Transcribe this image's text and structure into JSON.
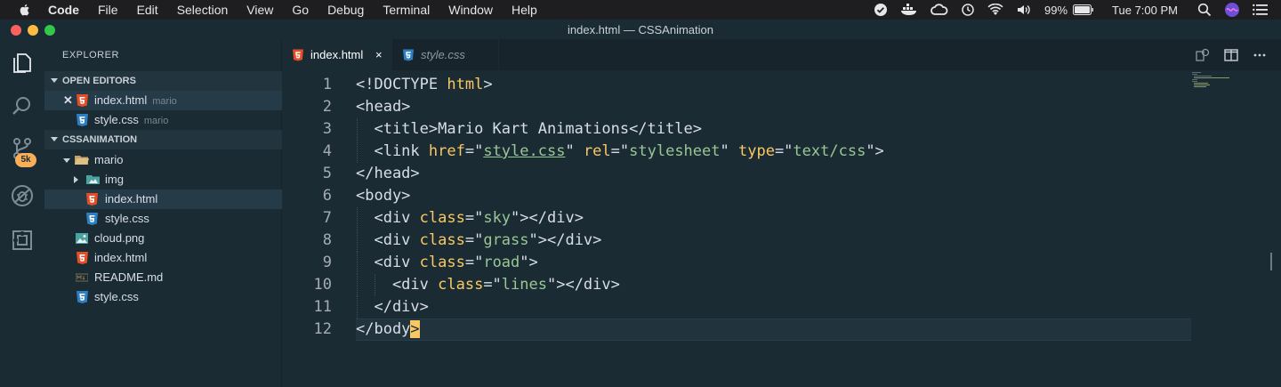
{
  "menubar": {
    "app": "Code",
    "items": [
      "File",
      "Edit",
      "Selection",
      "View",
      "Go",
      "Debug",
      "Terminal",
      "Window",
      "Help"
    ],
    "battery": "99%",
    "clock": "Tue 7:00 PM"
  },
  "window": {
    "title": "index.html — CSSAnimation"
  },
  "activity": {
    "badge": "5k"
  },
  "sidebar": {
    "title": "EXPLORER",
    "open_editors_header": "OPEN EDITORS",
    "open_editors": [
      {
        "name": "index.html",
        "folder": "mario",
        "icon": "html5-icon"
      },
      {
        "name": "style.css",
        "folder": "mario",
        "icon": "css3-icon"
      }
    ],
    "project_header": "CSSANIMATION",
    "tree": [
      {
        "name": "mario",
        "icon": "folder-open-icon"
      },
      {
        "name": "img",
        "icon": "image-folder-icon"
      },
      {
        "name": "index.html",
        "icon": "html5-icon"
      },
      {
        "name": "style.css",
        "icon": "css3-icon"
      },
      {
        "name": "cloud.png",
        "icon": "image-icon"
      },
      {
        "name": "index.html",
        "icon": "html5-icon"
      },
      {
        "name": "README.md",
        "icon": "markdown-icon"
      },
      {
        "name": "style.css",
        "icon": "css3-icon"
      }
    ]
  },
  "editor": {
    "tabs": [
      {
        "label": "index.html",
        "close": "×"
      },
      {
        "label": "style.css"
      }
    ],
    "lines": [
      {
        "n": "1",
        "tokens": [
          [
            "t",
            "<!DOCTYPE "
          ],
          [
            "a",
            "html"
          ],
          [
            "t",
            ">"
          ]
        ]
      },
      {
        "n": "2",
        "tokens": [
          [
            "t",
            "<head>"
          ]
        ]
      },
      {
        "n": "3",
        "tokens": [
          [
            "t",
            "  <title>"
          ],
          [
            "p",
            "Mario Kart Animations"
          ],
          [
            "t",
            "</title>"
          ]
        ]
      },
      {
        "n": "4",
        "tokens": [
          [
            "t",
            "  <link "
          ],
          [
            "a",
            "href"
          ],
          [
            "t",
            "=\""
          ],
          [
            "l",
            "style.css"
          ],
          [
            "t",
            "\" "
          ],
          [
            "a",
            "rel"
          ],
          [
            "t",
            "=\""
          ],
          [
            "s",
            "stylesheet"
          ],
          [
            "t",
            "\" "
          ],
          [
            "a",
            "type"
          ],
          [
            "t",
            "=\""
          ],
          [
            "s",
            "text/css"
          ],
          [
            "t",
            "\">"
          ]
        ]
      },
      {
        "n": "5",
        "tokens": [
          [
            "t",
            "</head>"
          ]
        ]
      },
      {
        "n": "6",
        "tokens": [
          [
            "t",
            "<body>"
          ]
        ]
      },
      {
        "n": "7",
        "tokens": [
          [
            "t",
            "  <div "
          ],
          [
            "a",
            "class"
          ],
          [
            "t",
            "=\""
          ],
          [
            "s",
            "sky"
          ],
          [
            "t",
            "\"></div>"
          ]
        ]
      },
      {
        "n": "8",
        "tokens": [
          [
            "t",
            "  <div "
          ],
          [
            "a",
            "class"
          ],
          [
            "t",
            "=\""
          ],
          [
            "s",
            "grass"
          ],
          [
            "t",
            "\"></div>"
          ]
        ]
      },
      {
        "n": "9",
        "tokens": [
          [
            "t",
            "  <div "
          ],
          [
            "a",
            "class"
          ],
          [
            "t",
            "=\""
          ],
          [
            "s",
            "road"
          ],
          [
            "t",
            "\">"
          ]
        ]
      },
      {
        "n": "10",
        "tokens": [
          [
            "t",
            "    <div "
          ],
          [
            "a",
            "class"
          ],
          [
            "t",
            "=\""
          ],
          [
            "s",
            "lines"
          ],
          [
            "t",
            "\"></div>"
          ]
        ]
      },
      {
        "n": "11",
        "tokens": [
          [
            "t",
            "  </div>"
          ]
        ]
      },
      {
        "n": "12",
        "tokens": [
          [
            "t",
            "</body"
          ]
        ],
        "cursor": ">"
      }
    ]
  },
  "colors": {
    "background": "#1b2b34",
    "attribute": "#fac863",
    "string": "#99c794",
    "text": "#d8dee9",
    "badge": "#f9ae58",
    "html_icon": "#e44d26",
    "css_icon": "#2d7fc4"
  }
}
